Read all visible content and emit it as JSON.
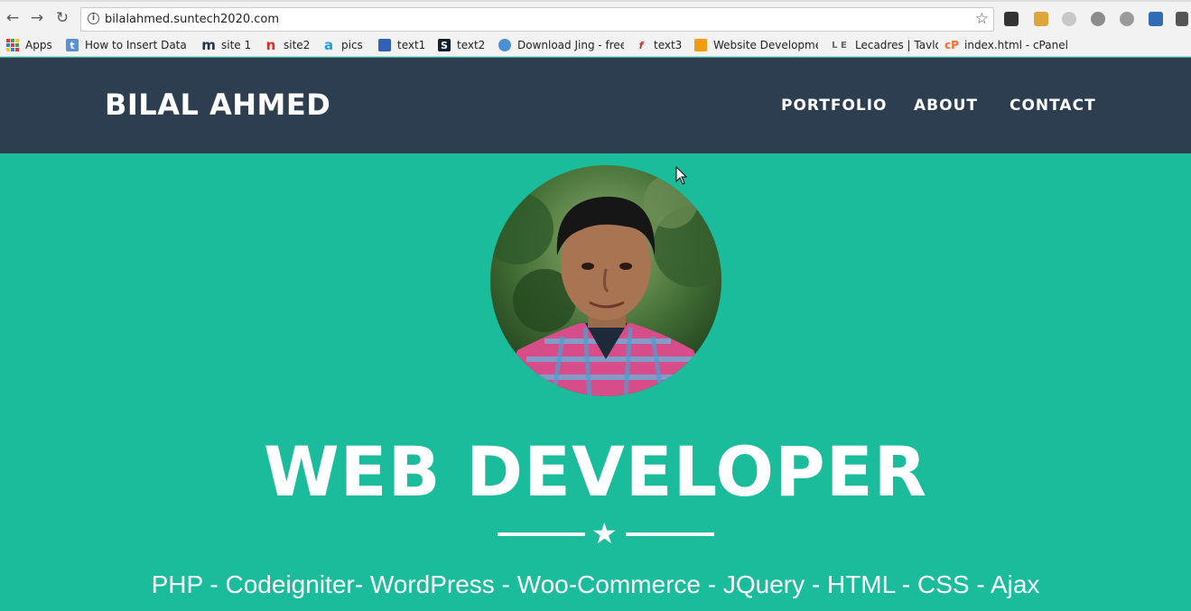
{
  "browser": {
    "url": "bilalahmed.suntech2020.com",
    "icons": [
      "back-arrow-icon",
      "forward-arrow-icon",
      "reload-icon",
      "info-icon",
      "bookmark-star-icon"
    ]
  },
  "bookmarks": [
    {
      "label": "Apps",
      "icon": "apps-grid-icon"
    },
    {
      "label": "How to Insert Data I",
      "icon": "t-icon",
      "color": "#5b8fd6"
    },
    {
      "label": "site 1",
      "icon": "m-icon",
      "color": "#22314e"
    },
    {
      "label": "site2",
      "icon": "n-icon",
      "color": "#e02a2a"
    },
    {
      "label": "pics",
      "icon": "a-icon",
      "color": "#1d9fe6"
    },
    {
      "label": "text1",
      "icon": "page-icon",
      "color": "#3161b5"
    },
    {
      "label": "text2",
      "icon": "s-icon",
      "color": "#0f1f2f"
    },
    {
      "label": "Download Jing - free",
      "icon": "globe-icon",
      "color": "#4d8fd6"
    },
    {
      "label": "text3",
      "icon": "feather-icon",
      "color": "#c0392b"
    },
    {
      "label": "Website Developme",
      "icon": "windows-icon",
      "color": "#f39c12"
    },
    {
      "label": "Lecadres | Tavlor",
      "icon": "le-icon",
      "color": "#666666"
    },
    {
      "label": "index.html - cPanel F",
      "icon": "cpanel-icon",
      "color": "#ff6c2c"
    }
  ],
  "site": {
    "brand": "BILAL AHMED",
    "nav": [
      "PORTFOLIO",
      "ABOUT",
      "CONTACT"
    ],
    "headline": "WEB DEVELOPER",
    "skills": "PHP - Codeigniter- WordPress - Woo-Commerce - JQuery - HTML - CSS - Ajax"
  },
  "colors": {
    "nav_bg": "#2c3e50",
    "hero_bg": "#1abc9c",
    "text": "#ffffff"
  }
}
